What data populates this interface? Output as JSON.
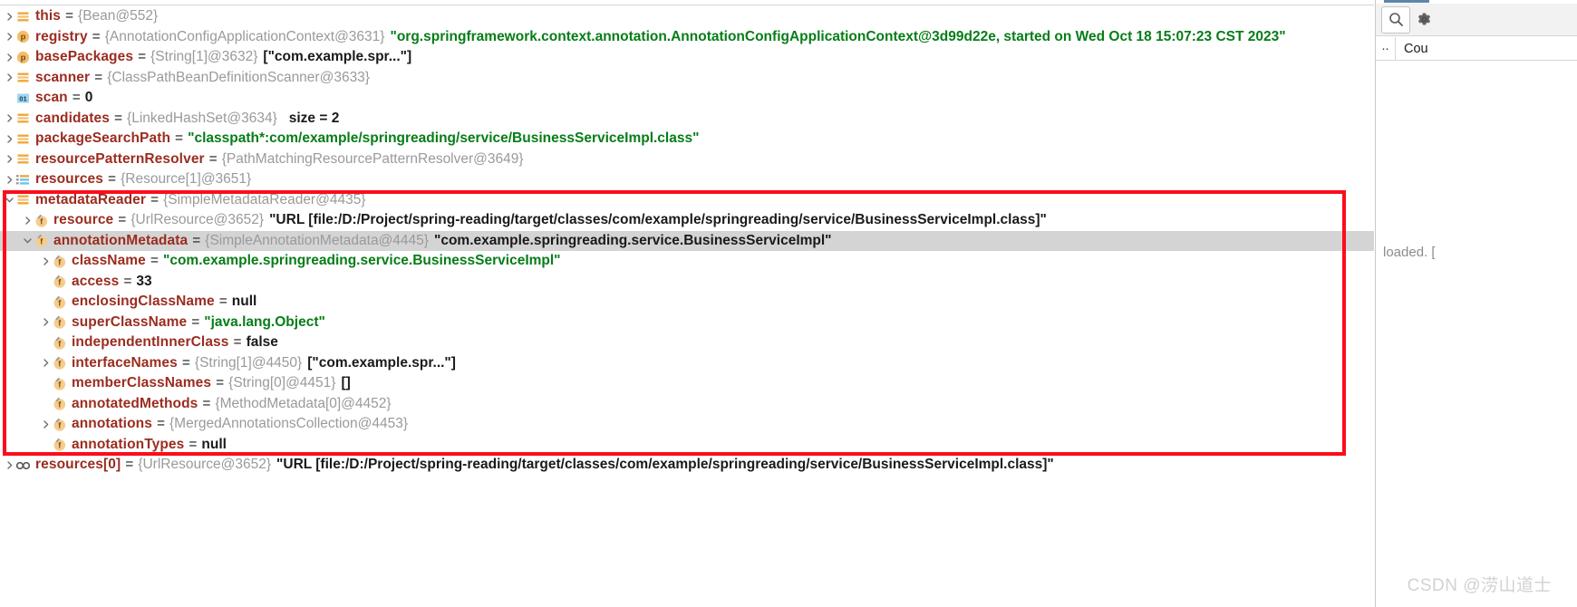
{
  "window": {
    "watermark": "CSDN @涝山道士"
  },
  "tree": {
    "rows": [
      {
        "indent": 0,
        "twisty": "collapsed",
        "icon": "field-list-icon",
        "name": "this",
        "eq": "=",
        "type": "{Bean@552}",
        "value": "",
        "value_kind": "none",
        "selected": false
      },
      {
        "indent": 0,
        "twisty": "collapsed",
        "icon": "property-icon",
        "name": "registry",
        "eq": "=",
        "type": "{AnnotationConfigApplicationContext@3631}",
        "value": "\"org.springframework.context.annotation.AnnotationConfigApplicationContext@3d99d22e, started on Wed Oct 18 15:07:23 CST 2023\"",
        "value_kind": "string",
        "selected": false
      },
      {
        "indent": 0,
        "twisty": "collapsed",
        "icon": "property-icon",
        "name": "basePackages",
        "eq": "=",
        "type": "{String[1]@3632}",
        "value": "[\"com.example.spr...\"]",
        "value_kind": "plain",
        "selected": false
      },
      {
        "indent": 0,
        "twisty": "collapsed",
        "icon": "field-list-icon",
        "name": "scanner",
        "eq": "=",
        "type": "{ClassPathBeanDefinitionScanner@3633}",
        "value": "",
        "value_kind": "none",
        "selected": false
      },
      {
        "indent": 0,
        "twisty": "none",
        "icon": "number-icon",
        "name": "scan",
        "eq": "=",
        "type": "",
        "value": "0",
        "value_kind": "number",
        "selected": false
      },
      {
        "indent": 0,
        "twisty": "collapsed",
        "icon": "field-list-icon",
        "name": "candidates",
        "eq": "=",
        "type": "{LinkedHashSet@3634}",
        "value": "size = 2",
        "value_kind": "size",
        "selected": false
      },
      {
        "indent": 0,
        "twisty": "collapsed",
        "icon": "field-list-icon",
        "name": "packageSearchPath",
        "eq": "=",
        "type": "",
        "value": "\"classpath*:com/example/springreading/service/BusinessServiceImpl.class\"",
        "value_kind": "string",
        "selected": false
      },
      {
        "indent": 0,
        "twisty": "collapsed",
        "icon": "field-list-icon",
        "name": "resourcePatternResolver",
        "eq": "=",
        "type": "{PathMatchingResourcePatternResolver@3649}",
        "value": "",
        "value_kind": "none",
        "selected": false
      },
      {
        "indent": 0,
        "twisty": "collapsed",
        "icon": "array-icon",
        "name": "resources",
        "eq": "=",
        "type": "{Resource[1]@3651}",
        "value": "",
        "value_kind": "none",
        "selected": false
      },
      {
        "indent": 0,
        "twisty": "expanded",
        "icon": "field-list-icon",
        "name": "metadataReader",
        "eq": "=",
        "type": "{SimpleMetadataReader@4435}",
        "value": "",
        "value_kind": "none",
        "selected": false
      },
      {
        "indent": 1,
        "twisty": "collapsed",
        "icon": "field-icon",
        "name": "resource",
        "eq": "=",
        "type": "{UrlResource@3652}",
        "value": "\"URL [file:/D:/Project/spring-reading/target/classes/com/example/springreading/service/BusinessServiceImpl.class]\"",
        "value_kind": "plain",
        "selected": false
      },
      {
        "indent": 1,
        "twisty": "expanded",
        "icon": "field-icon",
        "name": "annotationMetadata",
        "eq": "=",
        "type": "{SimpleAnnotationMetadata@4445}",
        "value": "\"com.example.springreading.service.BusinessServiceImpl\"",
        "value_kind": "plain",
        "selected": true
      },
      {
        "indent": 2,
        "twisty": "collapsed",
        "icon": "field-icon",
        "name": "className",
        "eq": "=",
        "type": "",
        "value": "\"com.example.springreading.service.BusinessServiceImpl\"",
        "value_kind": "string",
        "selected": false
      },
      {
        "indent": 2,
        "twisty": "none",
        "icon": "field-icon",
        "name": "access",
        "eq": "=",
        "type": "",
        "value": "33",
        "value_kind": "number",
        "selected": false
      },
      {
        "indent": 2,
        "twisty": "none",
        "icon": "field-icon",
        "name": "enclosingClassName",
        "eq": "=",
        "type": "",
        "value": "null",
        "value_kind": "plain",
        "selected": false
      },
      {
        "indent": 2,
        "twisty": "collapsed",
        "icon": "field-icon",
        "name": "superClassName",
        "eq": "=",
        "type": "",
        "value": "\"java.lang.Object\"",
        "value_kind": "string",
        "selected": false
      },
      {
        "indent": 2,
        "twisty": "none",
        "icon": "field-icon",
        "name": "independentInnerClass",
        "eq": "=",
        "type": "",
        "value": "false",
        "value_kind": "plain",
        "selected": false
      },
      {
        "indent": 2,
        "twisty": "collapsed",
        "icon": "field-icon",
        "name": "interfaceNames",
        "eq": "=",
        "type": "{String[1]@4450}",
        "value": "[\"com.example.spr...\"]",
        "value_kind": "plain",
        "selected": false
      },
      {
        "indent": 2,
        "twisty": "none",
        "icon": "field-icon",
        "name": "memberClassNames",
        "eq": "=",
        "type": "{String[0]@4451}",
        "value": "[]",
        "value_kind": "plain",
        "selected": false
      },
      {
        "indent": 2,
        "twisty": "none",
        "icon": "field-icon",
        "name": "annotatedMethods",
        "eq": "=",
        "type": "{MethodMetadata[0]@4452}",
        "value": "",
        "value_kind": "none",
        "selected": false
      },
      {
        "indent": 2,
        "twisty": "collapsed",
        "icon": "field-icon",
        "name": "annotations",
        "eq": "=",
        "type": "{MergedAnnotationsCollection@4453}",
        "value": "",
        "value_kind": "none",
        "selected": false
      },
      {
        "indent": 2,
        "twisty": "none",
        "icon": "field-icon",
        "name": "annotationTypes",
        "eq": "=",
        "type": "",
        "value": "null",
        "value_kind": "plain",
        "selected": false
      },
      {
        "indent": 0,
        "twisty": "collapsed",
        "icon": "infinity-icon",
        "name": "resources[0]",
        "eq": "=",
        "type": "{UrlResource@3652}",
        "value": "\"URL [file:/D:/Project/spring-reading/target/classes/com/example/springreading/service/BusinessServiceImpl.class]\"",
        "value_kind": "plain",
        "selected": false
      }
    ]
  },
  "annotation": {
    "highlight_color": "#fc0d1b"
  },
  "right_panel": {
    "search_icon": "search-icon",
    "settings_icon": "gear-icon",
    "header_dots": "..",
    "header_column": "Cou",
    "note": "loaded. ["
  }
}
